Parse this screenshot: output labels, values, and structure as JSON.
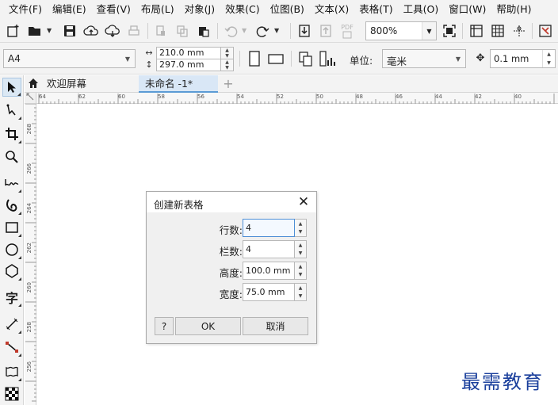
{
  "menubar": {
    "items": [
      "文件(F)",
      "编辑(E)",
      "查看(V)",
      "布局(L)",
      "对象(J)",
      "效果(C)",
      "位图(B)",
      "文本(X)",
      "表格(T)",
      "工具(O)",
      "窗口(W)",
      "帮助(H)"
    ]
  },
  "toolbar": {
    "zoom_value": "800%",
    "pdf_label": "PDF"
  },
  "propertybar": {
    "page_size": "A4",
    "width": "210.0 mm",
    "height": "297.0 mm",
    "unit_label": "单位:",
    "unit_value": "毫米",
    "nudge_value": "0.1 mm"
  },
  "tabs": {
    "welcome": "欢迎屏幕",
    "document": "未命名 -1*",
    "add": "+"
  },
  "ruler": {
    "h_labels": [
      "64",
      "62",
      "60",
      "58",
      "56",
      "54",
      "52",
      "50",
      "48",
      "46",
      "44",
      "42",
      "40"
    ],
    "v_labels": [
      "268",
      "266",
      "264",
      "262",
      "260",
      "258",
      "256"
    ],
    "corner": "毫米"
  },
  "dialog": {
    "title": "创建新表格",
    "close": "✕",
    "rows_label": "行数:",
    "rows_value": "4",
    "cols_label": "栏数:",
    "cols_value": "4",
    "height_label": "高度:",
    "height_value": "100.0 mm",
    "width_label": "宽度:",
    "width_value": "75.0 mm",
    "help_button": "?",
    "ok_button": "OK",
    "cancel_button": "取消"
  },
  "watermark": "最需教育"
}
